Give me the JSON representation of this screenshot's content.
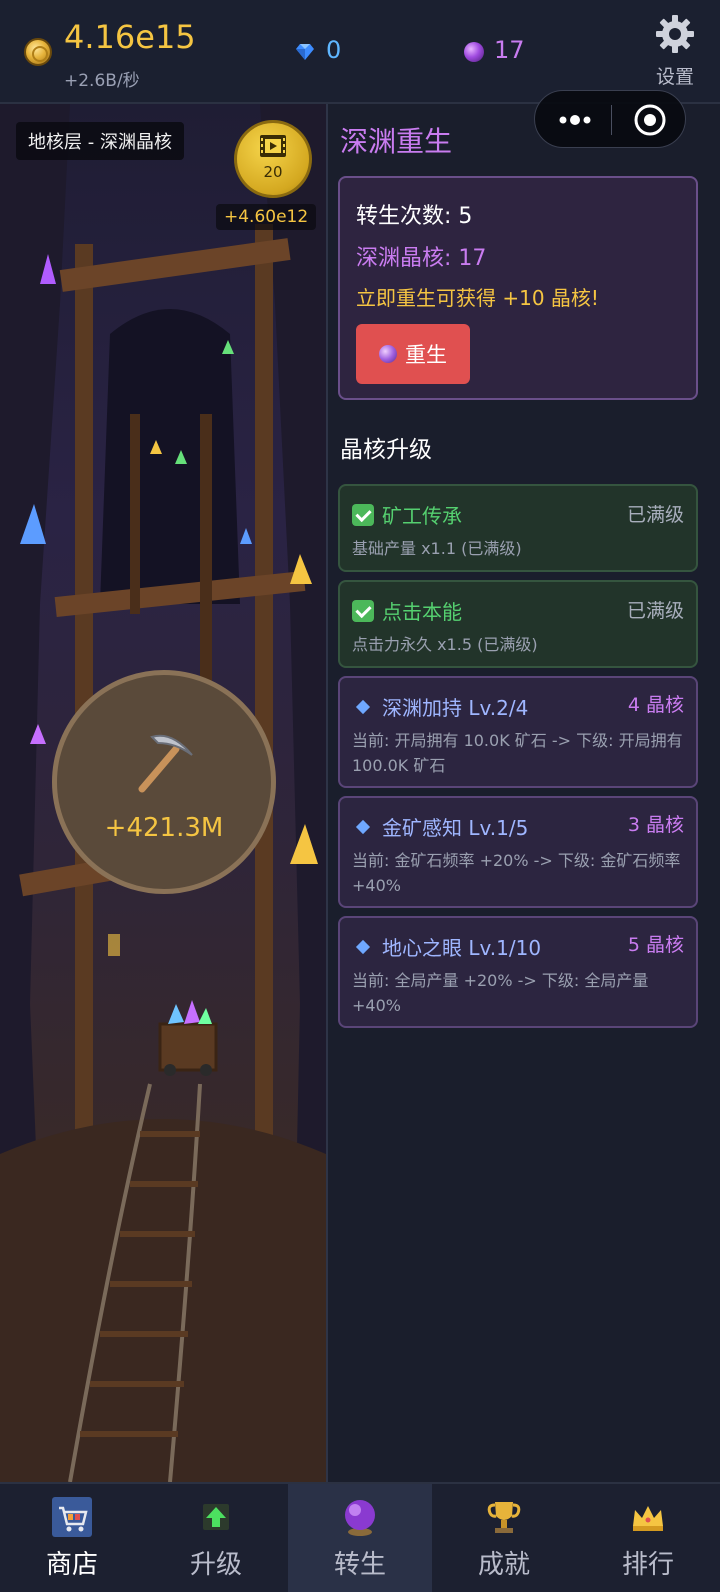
{
  "topbar": {
    "gold_value": "4.16e15",
    "gold_rate": "+2.6B/秒",
    "gems": "0",
    "crystals": "17",
    "settings_label": "设置"
  },
  "game": {
    "layer_label": "地核层 - 深渊晶核",
    "video_count": "20",
    "video_reward": "+4.60e12",
    "mine_value": "+421.3M"
  },
  "panel": {
    "title": "深渊重生",
    "rebirth_count": "转生次数: 5",
    "abyss_cores": "深渊晶核: 17",
    "rebirth_gain": "立即重生可获得 +10 晶核!",
    "rebirth_button": "重生",
    "upgrades_title": "晶核升级",
    "upgrades": [
      {
        "name": "矿工传承",
        "status": "已满级",
        "desc": "基础产量 x1.1 (已满级)"
      },
      {
        "name": "点击本能",
        "status": "已满级",
        "desc": "点击力永久 x1.5 (已满级)"
      },
      {
        "name": "深渊加持 Lv.2/4",
        "cost": "4 晶核",
        "desc": "当前: 开局拥有 10.0K 矿石  ->  下级: 开局拥有 100.0K 矿石"
      },
      {
        "name": "金矿感知 Lv.1/5",
        "cost": "3 晶核",
        "desc": "当前: 金矿石频率 +20%  ->  下级: 金矿石频率 +40%"
      },
      {
        "name": "地心之眼 Lv.1/10",
        "cost": "5 晶核",
        "desc": "当前: 全局产量 +20%  ->  下级: 全局产量 +40%"
      }
    ]
  },
  "nav": {
    "items": [
      {
        "label": "商店",
        "icon": "shop-cart-icon"
      },
      {
        "label": "升级",
        "icon": "upgrade-arrow-icon"
      },
      {
        "label": "转生",
        "icon": "rebirth-orb-icon"
      },
      {
        "label": "成就",
        "icon": "trophy-icon"
      },
      {
        "label": "排行",
        "icon": "crown-icon"
      }
    ],
    "active": "转生"
  },
  "colors": {
    "gold": "#f5c542",
    "purple": "#c97cf0",
    "green": "#55d070",
    "blue": "#9fb6ff",
    "rebirth_button": "#e05050"
  }
}
